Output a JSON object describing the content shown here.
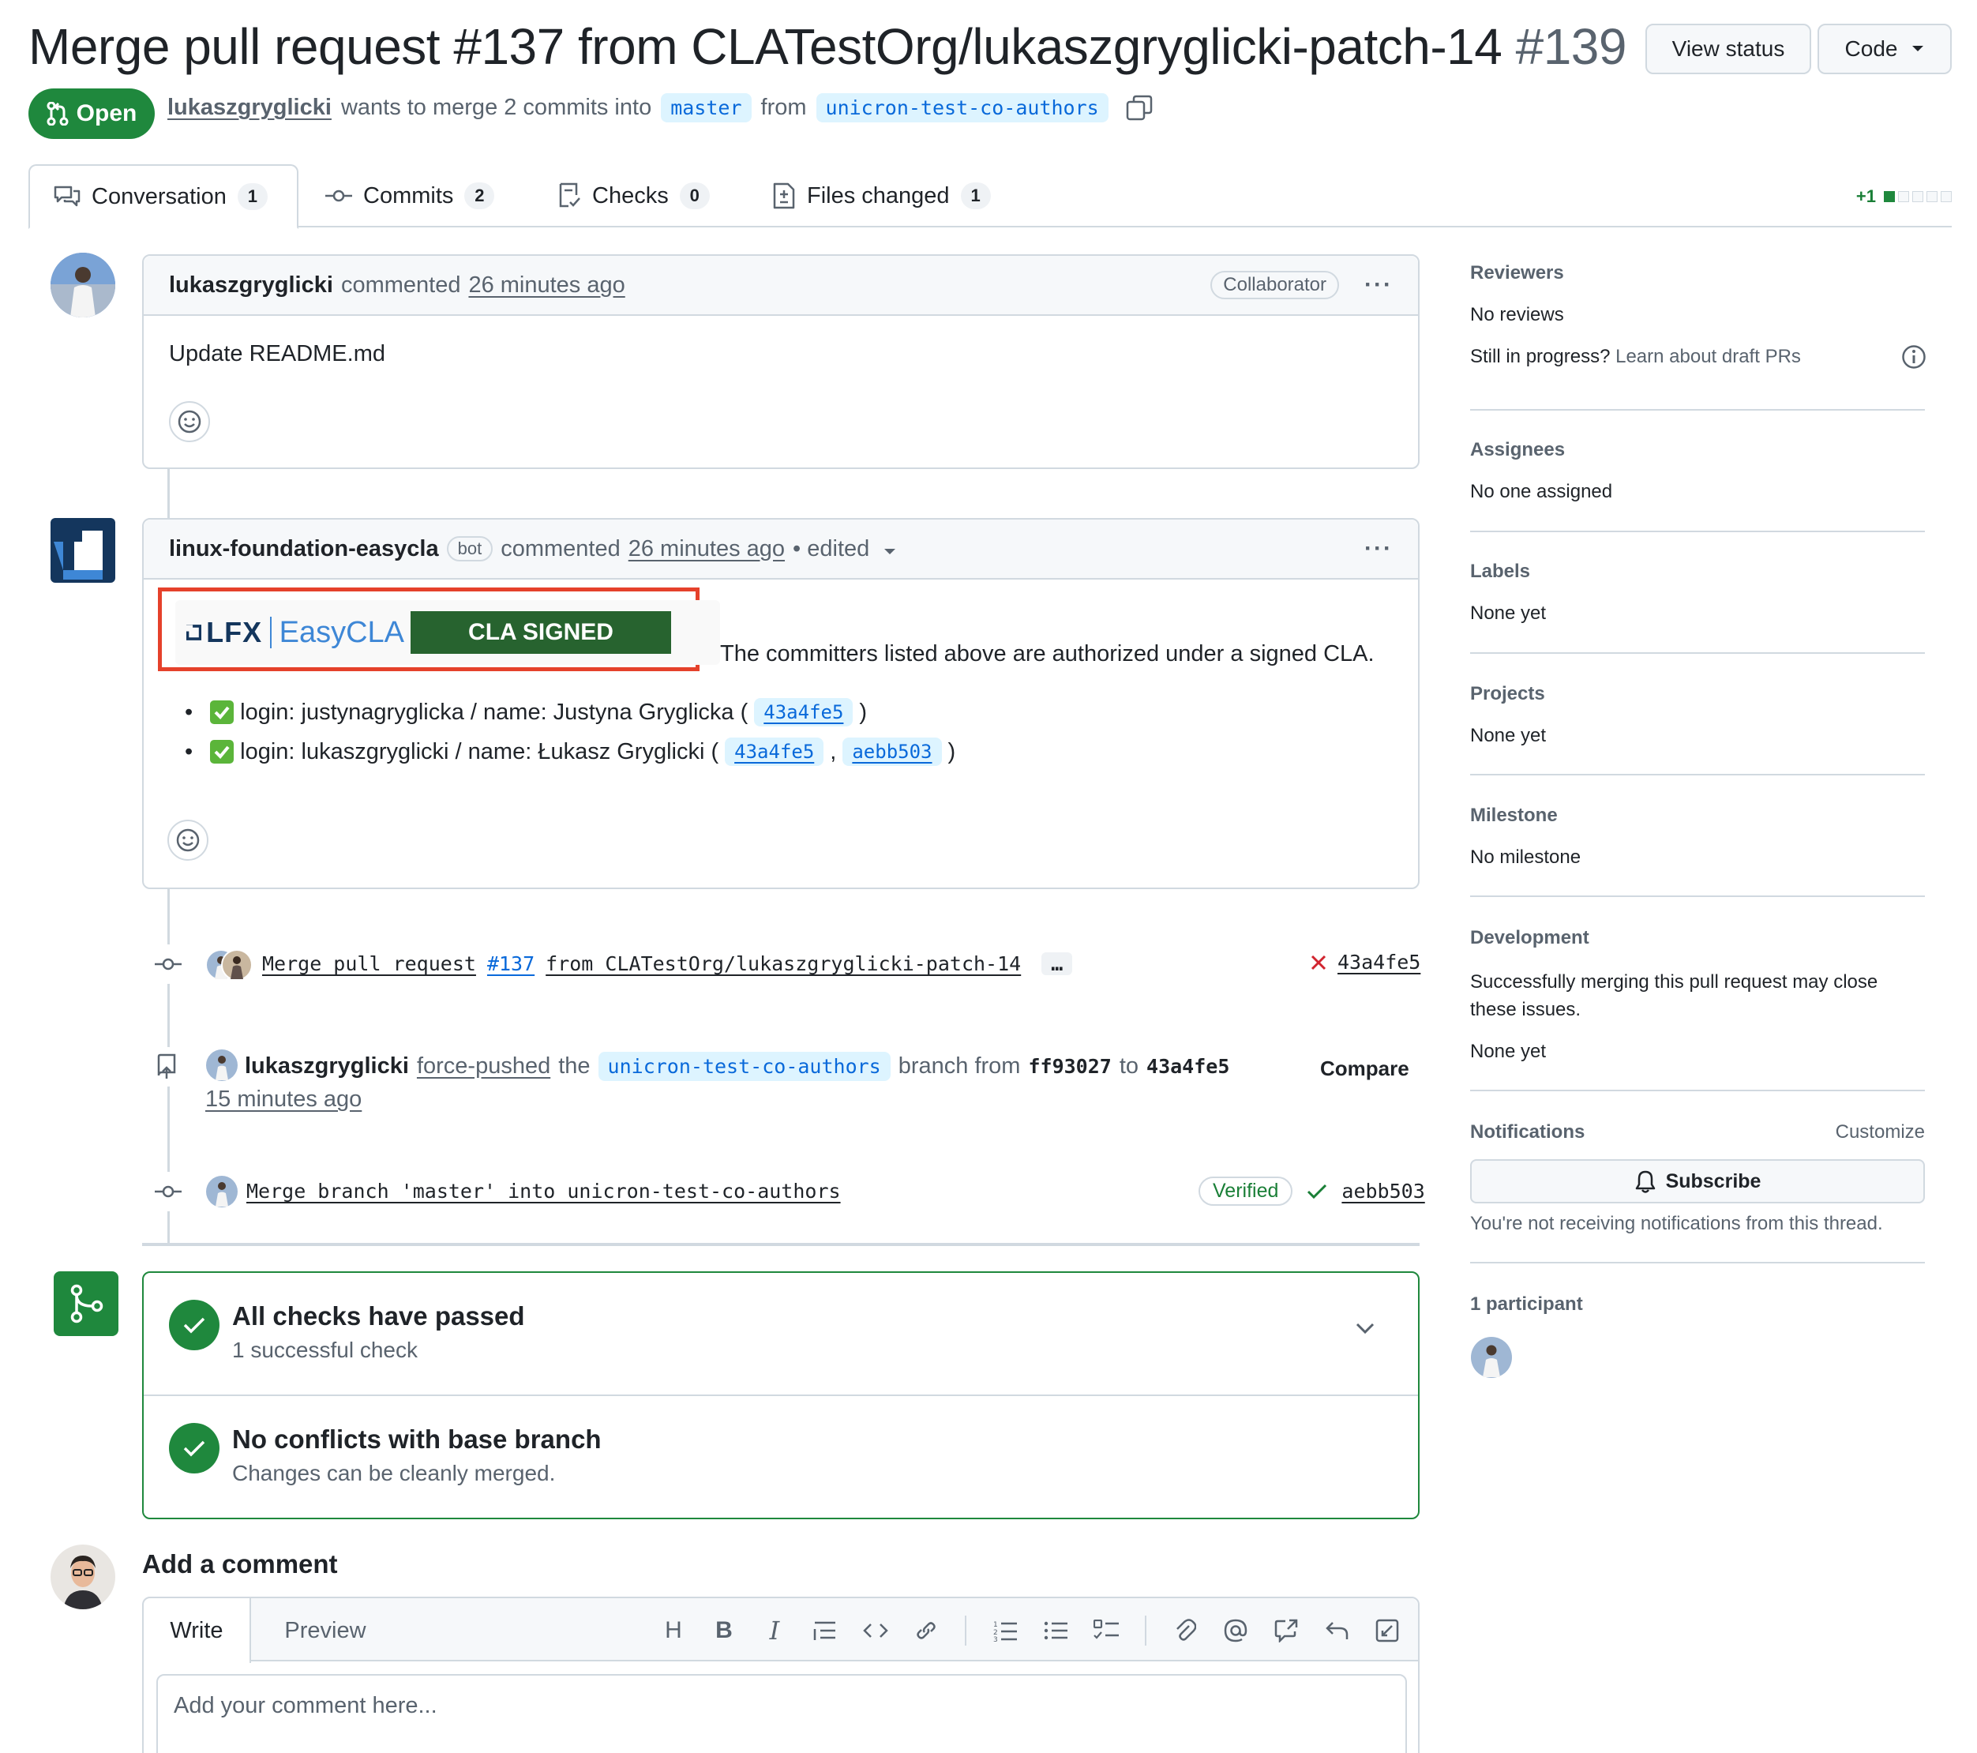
{
  "header": {
    "title": "Merge pull request #137 from CLATestOrg/lukaszgryglicki-patch-14",
    "number": "#139",
    "view_status": "View status",
    "code": "Code",
    "state": "Open",
    "author": "lukaszgryglicki",
    "merge_text": "wants to merge 2 commits into",
    "base_branch": "master",
    "from_text": "from",
    "head_branch": "unicron-test-co-authors"
  },
  "tabs": [
    {
      "label": "Conversation",
      "count": "1"
    },
    {
      "label": "Commits",
      "count": "2"
    },
    {
      "label": "Checks",
      "count": "0"
    },
    {
      "label": "Files changed",
      "count": "1"
    }
  ],
  "diffstat": {
    "added": "+1"
  },
  "comment1": {
    "author": "lukaszgryglicki",
    "action": "commented",
    "time": "26 minutes ago",
    "role": "Collaborator",
    "body": "Update README.md"
  },
  "comment2": {
    "author": "linux-foundation-easycla",
    "bot": "bot",
    "action": "commented",
    "time": "26 minutes ago",
    "edited": "• edited",
    "cla_logo": "LFX",
    "cla_product": "EasyCLA",
    "cla_badge": "CLA SIGNED",
    "cla_text": "The committers listed above are authorized under a signed CLA.",
    "bullet1_text": "login: justynagryglicka / name: Justyna Gryglicka (",
    "bullet1_sha": "43a4fe5",
    "bullet2_text": "login: lukaszgryglicki / name: Łukasz Gryglicki (",
    "bullet2_sha1": "43a4fe5",
    "bullet2_sha2": "aebb503",
    "close_paren": ")",
    "comma": ","
  },
  "events": {
    "commit1_msg_a": "Merge pull request",
    "commit1_msg_b": "#137",
    "commit1_msg_c": "from CLATestOrg/lukaszgryglicki-patch-14",
    "commit1_more": "…",
    "commit1_sha": "43a4fe5",
    "force_author": "lukaszgryglicki",
    "force_action": "force-pushed",
    "force_the": "the",
    "force_branch": "unicron-test-co-authors",
    "force_from": "branch from",
    "force_old": "ff93027",
    "force_to": "to",
    "force_new": "43a4fe5",
    "force_time": "15 minutes ago",
    "compare": "Compare",
    "commit2_msg": "Merge branch 'master' into unicron-test-co-authors",
    "commit2_verified": "Verified",
    "commit2_sha": "aebb503"
  },
  "merge_box": {
    "checks_title": "All checks have passed",
    "checks_sub": "1 successful check",
    "conflicts_title": "No conflicts with base branch",
    "conflicts_sub": "Changes can be cleanly merged."
  },
  "add_comment": {
    "title": "Add a comment",
    "write": "Write",
    "preview": "Preview",
    "heading_tool": "H",
    "bold_tool": "B",
    "italic_tool": "I",
    "placeholder": "Add your comment here..."
  },
  "sidebar": {
    "reviewers_h": "Reviewers",
    "reviewers_v": "No reviews",
    "draft_q": "Still in progress?",
    "draft_link": "Learn about draft PRs",
    "assignees_h": "Assignees",
    "assignees_v": "No one assigned",
    "labels_h": "Labels",
    "labels_v": "None yet",
    "projects_h": "Projects",
    "projects_v": "None yet",
    "milestone_h": "Milestone",
    "milestone_v": "No milestone",
    "development_h": "Development",
    "development_t": "Successfully merging this pull request may close these issues.",
    "development_v": "None yet",
    "notifications_h": "Notifications",
    "customize": "Customize",
    "subscribe": "Subscribe",
    "notif_text": "You're not receiving notifications from this thread.",
    "participants_h": "1 participant"
  },
  "colors": {
    "green": "#1f883d",
    "link": "#0969da",
    "highlight_border": "#e5412b",
    "cla_green": "#27632f"
  }
}
